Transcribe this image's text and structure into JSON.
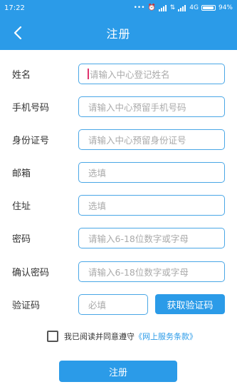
{
  "status_bar": {
    "time": "17:22",
    "network": "4G",
    "battery": "94%",
    "battery_level": 0.94,
    "icons": [
      "dots-icon",
      "alarm-icon",
      "signal-icon",
      "wifi-icon",
      "signal-icon"
    ]
  },
  "nav": {
    "title": "注册",
    "back_icon": "chevron-left-icon"
  },
  "form": {
    "fields": [
      {
        "label": "姓名",
        "placeholder": "请输入中心登记姓名"
      },
      {
        "label": "手机号码",
        "placeholder": "请输入中心预留手机号码"
      },
      {
        "label": "身份证号",
        "placeholder": "请输入中心预留身份证号"
      },
      {
        "label": "邮箱",
        "placeholder": "选填"
      },
      {
        "label": "住址",
        "placeholder": "选填"
      },
      {
        "label": "密码",
        "placeholder": "请输入6-18位数字或字母"
      },
      {
        "label": "确认密码",
        "placeholder": "请输入6-18位数字或字母"
      },
      {
        "label": "验证码",
        "placeholder": "必填"
      }
    ],
    "get_code_label": "获取验证码"
  },
  "agreement": {
    "text": "我已阅读并同意遵守",
    "link_text": "《网上服务条款》",
    "checked": false
  },
  "submit_label": "注册",
  "colors": {
    "primary": "#2b9be8",
    "input_border": "#4aa7e6",
    "cursor": "#e0336e"
  }
}
